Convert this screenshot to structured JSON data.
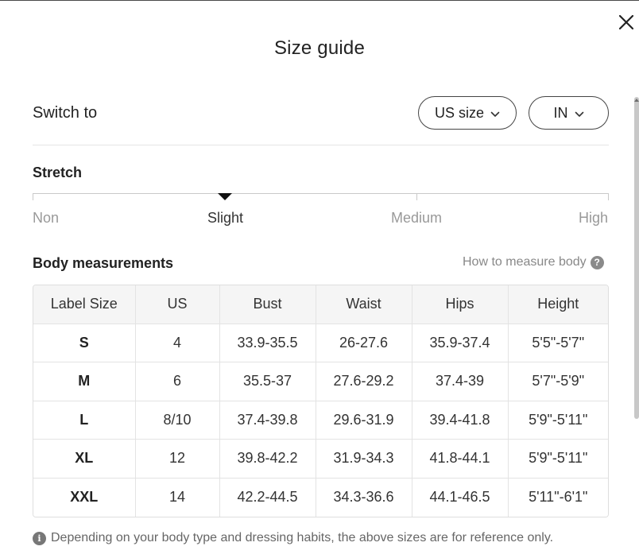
{
  "dialog": {
    "title": "Size guide"
  },
  "switch": {
    "label": "Switch to",
    "size_system": "US size",
    "unit": "IN"
  },
  "stretch": {
    "label": "Stretch",
    "options": [
      "Non",
      "Slight",
      "Medium",
      "High"
    ],
    "selected": "Slight"
  },
  "body": {
    "label": "Body measurements",
    "how_to_link": "How to measure body",
    "how_to_icon": "?"
  },
  "table": {
    "headers": [
      "Label Size",
      "US",
      "Bust",
      "Waist",
      "Hips",
      "Height"
    ],
    "rows": [
      [
        "S",
        "4",
        "33.9-35.5",
        "26-27.6",
        "35.9-37.4",
        "5'5\"-5'7\""
      ],
      [
        "M",
        "6",
        "35.5-37",
        "27.6-29.2",
        "37.4-39",
        "5'7\"-5'9\""
      ],
      [
        "L",
        "8/10",
        "37.4-39.8",
        "29.6-31.9",
        "39.4-41.8",
        "5'9\"-5'11\""
      ],
      [
        "XL",
        "12",
        "39.8-42.2",
        "31.9-34.3",
        "41.8-44.1",
        "5'9\"-5'11\""
      ],
      [
        "XXL",
        "14",
        "42.2-44.5",
        "34.3-36.6",
        "44.1-46.5",
        "5'11\"-6'1\""
      ]
    ]
  },
  "note": {
    "icon": "i",
    "text": "Depending on your body type and dressing habits, the above sizes are for reference only."
  },
  "icons": {
    "close": "close-icon",
    "chevron": "chevron-down-icon",
    "info": "info-icon",
    "help": "question-icon"
  }
}
